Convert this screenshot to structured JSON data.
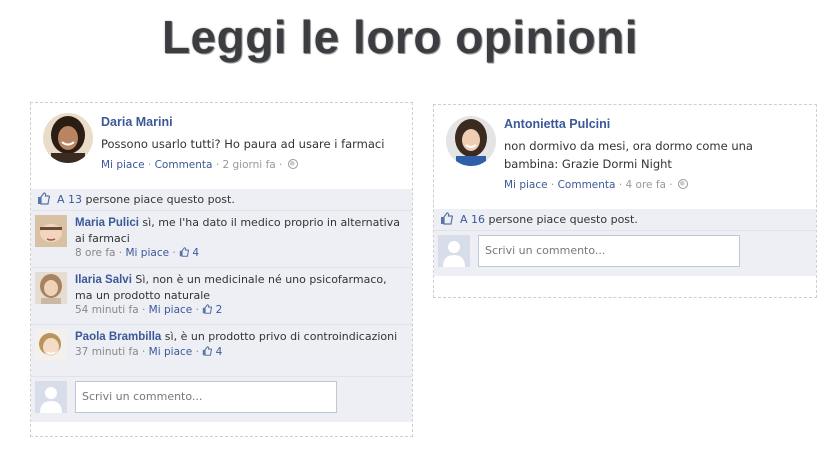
{
  "headline": "Leggi le loro opinioni",
  "posts": [
    {
      "author": "Daria Marini",
      "text": "Possono usarlo tutti? Ho paura ad usare i farmaci",
      "like_label": "Mi piace",
      "comment_label": "Commenta",
      "time": "2 giorni fa",
      "likes_prefix": "A 13",
      "likes_suffix": "persone piace questo post.",
      "comments": [
        {
          "author": "Maria Pulici",
          "text": "sì, me l'ha dato il medico proprio in alternativa ai farmaci",
          "time": "8 ore fa",
          "like_label": "Mi piace",
          "likes": "4"
        },
        {
          "author": "Ilaria Salvi",
          "text": "Sì, non è un medicinale né uno psicofarmaco, ma un prodotto naturale",
          "time": "54 minuti fa",
          "like_label": "Mi piace",
          "likes": "2"
        },
        {
          "author": "Paola Brambilla",
          "text": "sì, è un prodotto privo di controindicazioni",
          "time": "37 minuti fa",
          "like_label": "Mi piace",
          "likes": "4"
        }
      ],
      "write_placeholder": "Scrivi un commento..."
    },
    {
      "author": "Antonietta Pulcini",
      "text": "non dormivo da mesi, ora dormo come una bambina: Grazie Dormi Night",
      "like_label": "Mi piace",
      "comment_label": "Commenta",
      "time": "4 ore fa",
      "likes_prefix": "A 16",
      "likes_suffix": "persone piace questo post.",
      "write_placeholder": "Scrivi un commento..."
    }
  ],
  "colors": {
    "link": "#3b5998",
    "panel": "#edeff4",
    "headline": "#3b3d40"
  },
  "icons": [
    "thumbs-up-icon",
    "globe-icon",
    "default-avatar-icon"
  ]
}
